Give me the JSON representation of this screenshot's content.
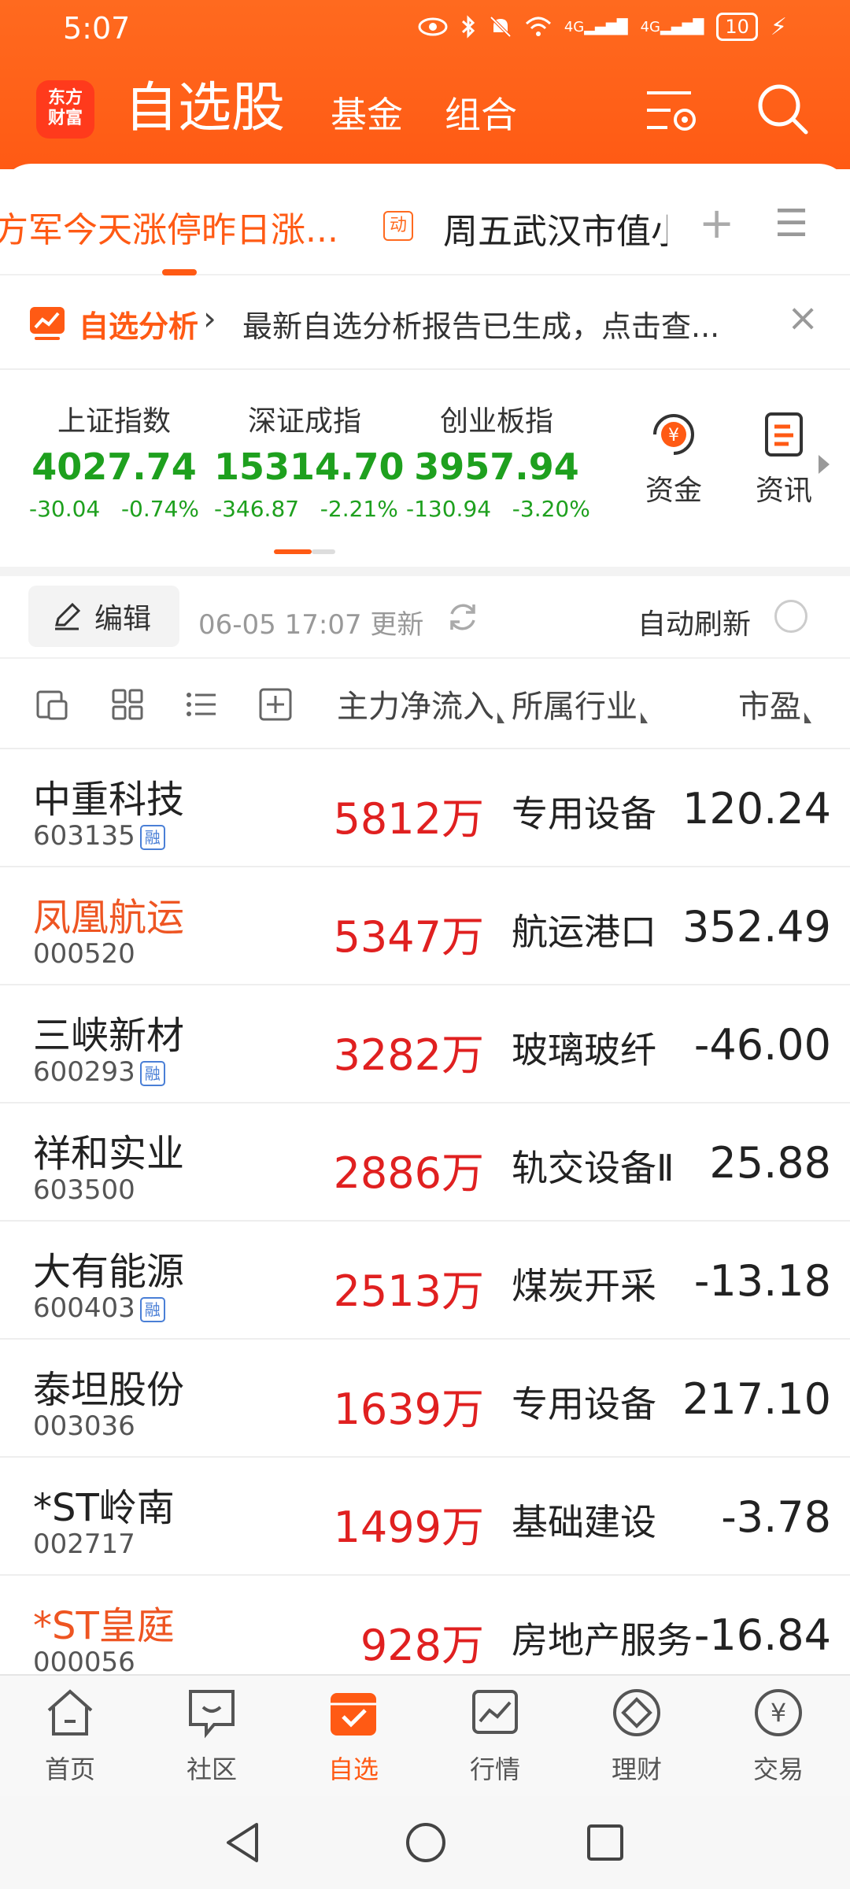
{
  "status_bar": {
    "time": "5:07",
    "battery": "10",
    "signal_1": "4G",
    "signal_2": "4G"
  },
  "header": {
    "logo_line1": "东方",
    "logo_line2": "财富",
    "title": "自选股",
    "tab_fund": "基金",
    "tab_combo": "组合"
  },
  "groups": {
    "active": "方军今天涨停昨日涨...",
    "dong_badge": "动",
    "second": "周五武汉市值小",
    "plus": "+"
  },
  "notice": {
    "title": "自选分析",
    "text": "最新自选分析报告已生成，点击查..."
  },
  "indices": [
    {
      "name": "上证指数",
      "value": "4027.74",
      "change": "-30.04",
      "pct": "-0.74%"
    },
    {
      "name": "深证成指",
      "value": "15314.70",
      "change": "-346.87",
      "pct": "-2.21%"
    },
    {
      "name": "创业板指",
      "value": "3957.94",
      "change": "-130.94",
      "pct": "-3.20%"
    }
  ],
  "quick_buttons": {
    "funds": "资金",
    "news": "资讯",
    "funds_glyph": "¥"
  },
  "toolbar": {
    "edit": "编辑",
    "updated": "06-05 17:07 更新",
    "auto_refresh": "自动刷新"
  },
  "columns": {
    "flow": "主力净流入",
    "industry": "所属行业",
    "pe": "市盈"
  },
  "rows": [
    {
      "name": "中重科技",
      "code": "603135",
      "rong": "融",
      "flow": "5812万",
      "industry": "专用设备",
      "pe": "120.24"
    },
    {
      "name": "凤凰航运",
      "code": "000520",
      "rong": "",
      "flow": "5347万",
      "industry": "航运港口",
      "pe": "352.49"
    },
    {
      "name": "三峡新材",
      "code": "600293",
      "rong": "融",
      "flow": "3282万",
      "industry": "玻璃玻纤",
      "pe": "-46.00"
    },
    {
      "name": "祥和实业",
      "code": "603500",
      "rong": "",
      "flow": "2886万",
      "industry": "轨交设备Ⅱ",
      "pe": "25.88"
    },
    {
      "name": "大有能源",
      "code": "600403",
      "rong": "融",
      "flow": "2513万",
      "industry": "煤炭开采",
      "pe": "-13.18"
    },
    {
      "name": "泰坦股份",
      "code": "003036",
      "rong": "",
      "flow": "1639万",
      "industry": "专用设备",
      "pe": "217.10"
    },
    {
      "name": "*ST岭南",
      "code": "002717",
      "rong": "",
      "flow": "1499万",
      "industry": "基础建设",
      "pe": "-3.78"
    },
    {
      "name": "*ST皇庭",
      "code": "000056",
      "rong": "",
      "flow": "928万",
      "industry": "房地产服务",
      "pe": "-16.84"
    }
  ],
  "bottom_nav": [
    {
      "label": "首页"
    },
    {
      "label": "社区"
    },
    {
      "label": "自选"
    },
    {
      "label": "行情"
    },
    {
      "label": "理财"
    },
    {
      "label": "交易"
    }
  ],
  "nav_glyphs": {
    "trade": "¥"
  },
  "colors": {
    "brand": "#ff5a14",
    "down": "#1ea01e",
    "up": "#e02020",
    "highlight": "#ee5522"
  }
}
